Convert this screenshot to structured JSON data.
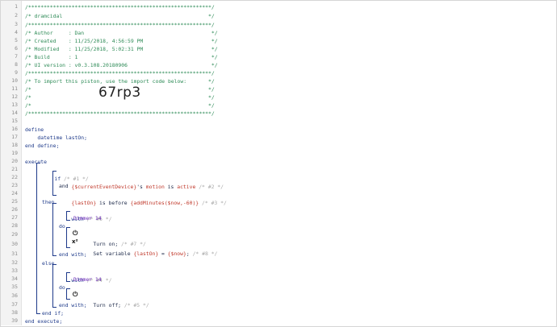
{
  "lines": [
    {
      "num": "1",
      "text": "/***********************************************************/"
    },
    {
      "num": "2",
      "text": "/* dramcidal                                               */"
    },
    {
      "num": "3",
      "text": "/***********************************************************/"
    },
    {
      "num": "4",
      "text": "/* Author     : Dan                                         */"
    },
    {
      "num": "5",
      "text": "/* Created    : 11/25/2018, 4:56:59 PM                      */"
    },
    {
      "num": "6",
      "text": "/* Modified   : 11/25/2018, 5:02:31 PM                      */"
    },
    {
      "num": "7",
      "text": "/* Build      : 1                                           */"
    },
    {
      "num": "8",
      "text": "/* UI version : v0.3.108.20180906                           */"
    },
    {
      "num": "9",
      "text": "/***********************************************************/"
    },
    {
      "num": "10",
      "text": "/* To import this piston, use the import code below:       */"
    },
    {
      "num": "11",
      "text": "/*                                                         */"
    },
    {
      "num": "12",
      "text": "/*                                                         */"
    },
    {
      "num": "13",
      "text": "/*                                                         */"
    },
    {
      "num": "14",
      "text": "/***********************************************************/"
    },
    {
      "num": "15",
      "text": ""
    },
    {
      "num": "16",
      "text": "define"
    },
    {
      "num": "17",
      "text": "    datetime lastOn;"
    },
    {
      "num": "18",
      "text": "end define;"
    },
    {
      "num": "19",
      "text": ""
    },
    {
      "num": "20",
      "text": "execute"
    },
    {
      "num": "21",
      "text": ""
    },
    {
      "num": "22",
      "text": ""
    },
    {
      "num": "23",
      "text": ""
    },
    {
      "num": "24",
      "text": ""
    },
    {
      "num": "25",
      "text": ""
    },
    {
      "num": "26",
      "text": ""
    },
    {
      "num": "27",
      "text": ""
    },
    {
      "num": "28",
      "text": ""
    },
    {
      "num": "29",
      "text": ""
    },
    {
      "num": "30",
      "text": ""
    },
    {
      "num": "31",
      "text": ""
    },
    {
      "num": "32",
      "text": ""
    },
    {
      "num": "33",
      "text": ""
    },
    {
      "num": "34",
      "text": ""
    },
    {
      "num": "35",
      "text": ""
    },
    {
      "num": "36",
      "text": ""
    },
    {
      "num": "37",
      "text": ""
    },
    {
      "num": "38",
      "text": ""
    },
    {
      "num": "39",
      "text": "end execute;"
    }
  ],
  "import_code": "67rp3",
  "tokens": {
    "if_kw": "if",
    "if_tag": "/* #1 */",
    "cond1_device": "{$currentEventDevice}",
    "cond1_poss": "'s ",
    "cond1_attr": "motion",
    "cond1_is": " is ",
    "cond1_val": "active",
    "cond1_tag": "/* #2 */",
    "and_kw": "and",
    "cond2_var": "{lastOn}",
    "cond2_is": " is before ",
    "cond2_expr": "{addMinutes($now,-60)}",
    "cond2_tag": "/* #3 */",
    "then_kw": "then",
    "with1_kw": "with",
    "with1_tag": "/* #6 */",
    "dimmer1": "Dimmer 14",
    "do1_kw": "do",
    "turn_on": "Turn on;",
    "turn_on_tag": "/* #7 */",
    "set_var": "Set variable ",
    "set_var_name": "{lastOn}",
    "set_eq": " = ",
    "set_val": "{$now}",
    "set_end": ";",
    "set_tag": "/* #8 */",
    "endwith1": "end with;",
    "else_kw": "else",
    "with2_kw": "with",
    "with2_tag": "/* #4 */",
    "dimmer2": "Dimmer 14",
    "do2_kw": "do",
    "turn_off": "Turn off;",
    "turn_off_tag": "/* #5 */",
    "endwith2": "end with;",
    "endif": "end if;"
  },
  "colors": {
    "comment": "#2e8b57",
    "keyword": "#1e3a8a",
    "variable": "#c0392b",
    "device": "#6a28b8",
    "faint_comment": "#a8a8a8"
  },
  "icons": {
    "power": "power-icon",
    "variable": "variable-icon"
  }
}
